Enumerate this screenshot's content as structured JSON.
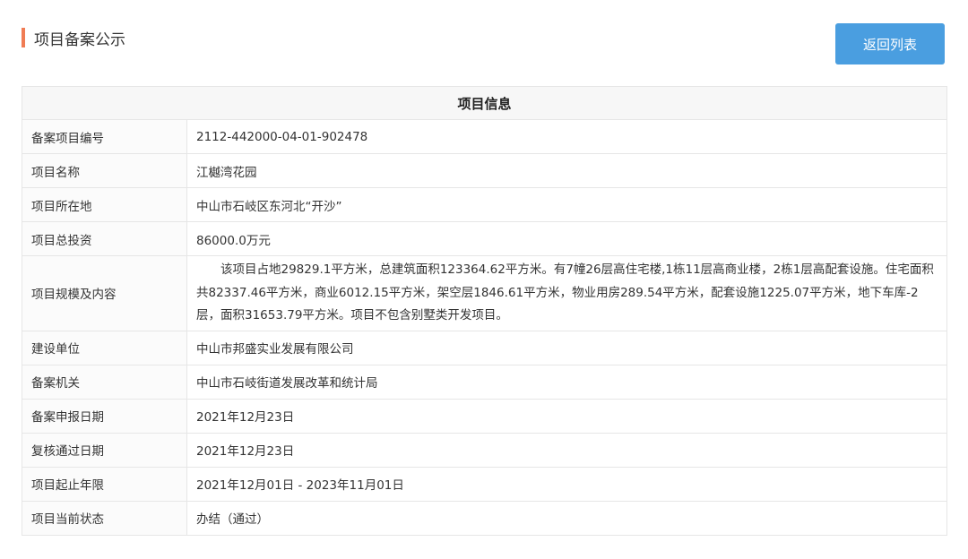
{
  "header": {
    "title": "项目备案公示",
    "accent_color": "#f07c54"
  },
  "actions": {
    "back_label": "返回列表",
    "back_color": "#4a9ee0"
  },
  "table": {
    "heading": "项目信息",
    "rows": [
      {
        "label": "备案项目编号",
        "value": "2112-442000-04-01-902478"
      },
      {
        "label": "项目名称",
        "value": "江樾湾花园"
      },
      {
        "label": "项目所在地",
        "value": "中山市石岐区东河北“开沙”"
      },
      {
        "label": "项目总投资",
        "value": "86000.0万元"
      },
      {
        "label": "项目规模及内容",
        "value": "该项目占地29829.1平方米，总建筑面积123364.62平方米。有7幢26层高住宅楼,1栋11层高商业楼，2栋1层高配套设施。住宅面积共82337.46平方米，商业6012.15平方米，架空层1846.61平方米，物业用房289.54平方米，配套设施1225.07平方米，地下车库-2层，面积31653.79平方米。项目不包含别墅类开发项目。"
      },
      {
        "label": "建设单位",
        "value": "中山市邦盛实业发展有限公司"
      },
      {
        "label": "备案机关",
        "value": "中山市石岐街道发展改革和统计局"
      },
      {
        "label": "备案申报日期",
        "value": "2021年12月23日"
      },
      {
        "label": "复核通过日期",
        "value": "2021年12月23日"
      },
      {
        "label": "项目起止年限",
        "value": "2021年12月01日 - 2023年11月01日"
      },
      {
        "label": "项目当前状态",
        "value": "办结（通过）"
      }
    ]
  }
}
